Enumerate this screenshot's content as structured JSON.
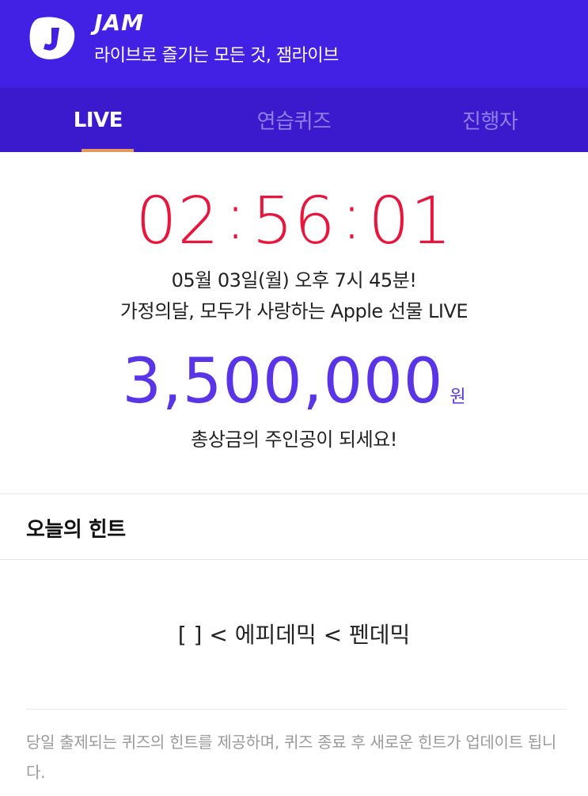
{
  "header": {
    "brand": "JAM",
    "tagline": "라이브로 즐기는 모든 것, 잼라이브",
    "logo_icon": "jam-logo-icon",
    "bg_color": "#4321e4"
  },
  "tabs": [
    {
      "label": "LIVE",
      "active": true
    },
    {
      "label": "연습퀴즈",
      "active": false
    },
    {
      "label": "진행자",
      "active": false
    }
  ],
  "countdown": {
    "hours": "02",
    "minutes": "56",
    "seconds": "01",
    "separator": ":",
    "color": "#e9153c"
  },
  "event": {
    "date": "05월 03일(월) 오후 7시 45분!",
    "title": "가정의달, 모두가 사랑하는 Apple 선물 LIVE"
  },
  "prize": {
    "amount": "3,500,000",
    "unit": "원",
    "caption": "총상금의 주인공이 되세요!",
    "color": "#5a35e8"
  },
  "hint": {
    "heading": "오늘의 힌트",
    "text": "[ ] < 에피데믹 < 펜데믹",
    "note": "당일 출제되는 퀴즈의 힌트를 제공하며, 퀴즈 종료 후 새로운 힌트가 업데이트 됩니다."
  }
}
